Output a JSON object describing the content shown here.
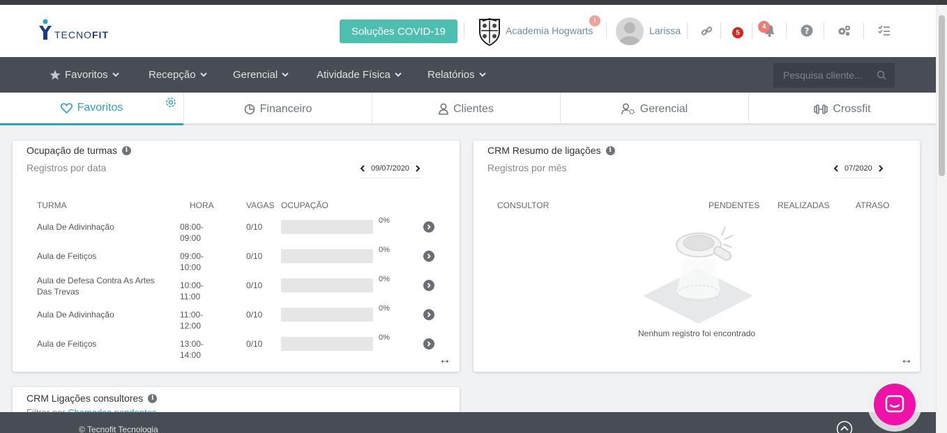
{
  "header": {
    "logo_text_light": "TECNO",
    "logo_text_bold": "FIT",
    "covid_button": "Soluções COVID-19",
    "academy_name": "Academia Hogwarts",
    "academy_alert": "!",
    "user_name": "Larissa",
    "chat_badge": "5",
    "bell_badge": "4"
  },
  "nav": {
    "items": [
      {
        "label": "Favoritos"
      },
      {
        "label": "Recepção"
      },
      {
        "label": "Gerencial"
      },
      {
        "label": "Atividade Física"
      },
      {
        "label": "Relatórios"
      }
    ],
    "search_placeholder": "Pesquisa cliente..."
  },
  "tabs": [
    {
      "label": "Favoritos",
      "icon": "heart-icon"
    },
    {
      "label": "Financeiro",
      "icon": "pie-chart-icon"
    },
    {
      "label": "Clientes",
      "icon": "user-icon"
    },
    {
      "label": "Gerencial",
      "icon": "user-gear-icon"
    },
    {
      "label": "Crossfit",
      "icon": "dumbbell-icon"
    }
  ],
  "ocupacao": {
    "title": "Ocupação de turmas",
    "subtitle": "Registros por data",
    "date": "09/07/2020",
    "columns": [
      "TURMA",
      "HORA",
      "VAGAS",
      "OCUPAÇÃO"
    ],
    "rows": [
      {
        "turma": "Aula De Adivinhação",
        "hora": "08:00-09:00",
        "vagas": "0/10",
        "pct": "0%",
        "fill": 0
      },
      {
        "turma": "Aula de Feitiços",
        "hora": "09:00-10:00",
        "vagas": "0/10",
        "pct": "0%",
        "fill": 0
      },
      {
        "turma": "Aula de Defesa Contra As Artes Das Trevas",
        "hora": "10:00-11:00",
        "vagas": "0/10",
        "pct": "0%",
        "fill": 0
      },
      {
        "turma": "Aula De Adivinhação",
        "hora": "11:00-12:00",
        "vagas": "0/10",
        "pct": "0%",
        "fill": 0
      },
      {
        "turma": "Aula de Feitiços",
        "hora": "13:00-14:00",
        "vagas": "0/10",
        "pct": "0%",
        "fill": 0
      }
    ]
  },
  "crm_resumo": {
    "title": "CRM Resumo de ligações",
    "subtitle": "Registros por mês",
    "date": "07/2020",
    "columns": [
      "CONSULTOR",
      "PENDENTES",
      "REALIZADAS",
      "ATRASO"
    ],
    "empty_message": "Nenhum registro foi encontrado"
  },
  "crm_consultores": {
    "title": "CRM Ligações consultores",
    "filter_label": "Filtrar por",
    "filter_value": "Chamadas pendentes"
  },
  "footer": {
    "copyright": "© Tecnofit Tecnologia"
  },
  "colors": {
    "accent": "#2a9fd0",
    "covid": "#4dbfb0",
    "navbar": "#474c55",
    "badge": "#d9251c",
    "chat": "#f012a8"
  }
}
